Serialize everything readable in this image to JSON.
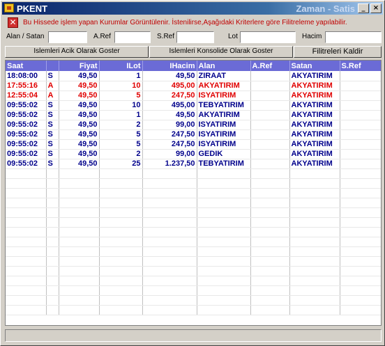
{
  "window": {
    "title": "PKENT",
    "subtitle": "Zaman - Satis",
    "min_glyph": "_",
    "close_glyph": "×"
  },
  "info": {
    "icon_name": "error-icon",
    "text": "Bu Hissede işlem yapan Kurumlar Görüntülenir. İstenilirse,Aşağıdaki Kriterlere göre Filitreleme yapılabilir."
  },
  "filters": {
    "alan_satan_label": "Alan / Satan",
    "aref_label": "A.Ref",
    "sref_label": "S.Ref",
    "lot_label": "Lot",
    "hacim_label": "Hacim",
    "alan_satan_value": "",
    "aref_value": "",
    "sref_value": "",
    "lot_value": "",
    "hacim_value": ""
  },
  "buttons": {
    "acik_label": "Islemleri Acik Olarak Goster",
    "konsolide_label": "Islemleri Konsolide Olarak Goster",
    "kaldir_label": "Filitreleri Kaldir"
  },
  "table": {
    "columns": [
      "Saat",
      "",
      "Fiyat",
      "ILot",
      "IHacim",
      "Alan",
      "A.Ref",
      "Satan",
      "S.Ref"
    ],
    "rows": [
      {
        "saat": "18:08:00",
        "side": "S",
        "fiyat": "49,50",
        "lot": "1",
        "hacim": "49,50",
        "alan": "ZIRAAT",
        "aref": "",
        "satan": "AKYATIRIM",
        "sref": "",
        "color": "blue"
      },
      {
        "saat": "17:55:16",
        "side": "A",
        "fiyat": "49,50",
        "lot": "10",
        "hacim": "495,00",
        "alan": "AKYATIRIM",
        "aref": "",
        "satan": "AKYATIRIM",
        "sref": "",
        "color": "red"
      },
      {
        "saat": "12:55:04",
        "side": "A",
        "fiyat": "49,50",
        "lot": "5",
        "hacim": "247,50",
        "alan": "ISYATIRIM",
        "aref": "",
        "satan": "AKYATIRIM",
        "sref": "",
        "color": "red"
      },
      {
        "saat": "09:55:02",
        "side": "S",
        "fiyat": "49,50",
        "lot": "10",
        "hacim": "495,00",
        "alan": "TEBYATIRIM",
        "aref": "",
        "satan": "AKYATIRIM",
        "sref": "",
        "color": "blue"
      },
      {
        "saat": "09:55:02",
        "side": "S",
        "fiyat": "49,50",
        "lot": "1",
        "hacim": "49,50",
        "alan": "AKYATIRIM",
        "aref": "",
        "satan": "AKYATIRIM",
        "sref": "",
        "color": "blue"
      },
      {
        "saat": "09:55:02",
        "side": "S",
        "fiyat": "49,50",
        "lot": "2",
        "hacim": "99,00",
        "alan": "ISYATIRIM",
        "aref": "",
        "satan": "AKYATIRIM",
        "sref": "",
        "color": "blue"
      },
      {
        "saat": "09:55:02",
        "side": "S",
        "fiyat": "49,50",
        "lot": "5",
        "hacim": "247,50",
        "alan": "ISYATIRIM",
        "aref": "",
        "satan": "AKYATIRIM",
        "sref": "",
        "color": "blue"
      },
      {
        "saat": "09:55:02",
        "side": "S",
        "fiyat": "49,50",
        "lot": "5",
        "hacim": "247,50",
        "alan": "ISYATIRIM",
        "aref": "",
        "satan": "AKYATIRIM",
        "sref": "",
        "color": "blue"
      },
      {
        "saat": "09:55:02",
        "side": "S",
        "fiyat": "49,50",
        "lot": "2",
        "hacim": "99,00",
        "alan": "GEDIK",
        "aref": "",
        "satan": "AKYATIRIM",
        "sref": "",
        "color": "blue"
      },
      {
        "saat": "09:55:02",
        "side": "S",
        "fiyat": "49,50",
        "lot": "25",
        "hacim": "1.237,50",
        "alan": "TEBYATIRIM",
        "aref": "",
        "satan": "AKYATIRIM",
        "sref": "",
        "color": "blue"
      }
    ]
  },
  "colors": {
    "header_bg": "#6b6bd6",
    "buy_color": "#e00000",
    "sell_color": "#00008b"
  }
}
